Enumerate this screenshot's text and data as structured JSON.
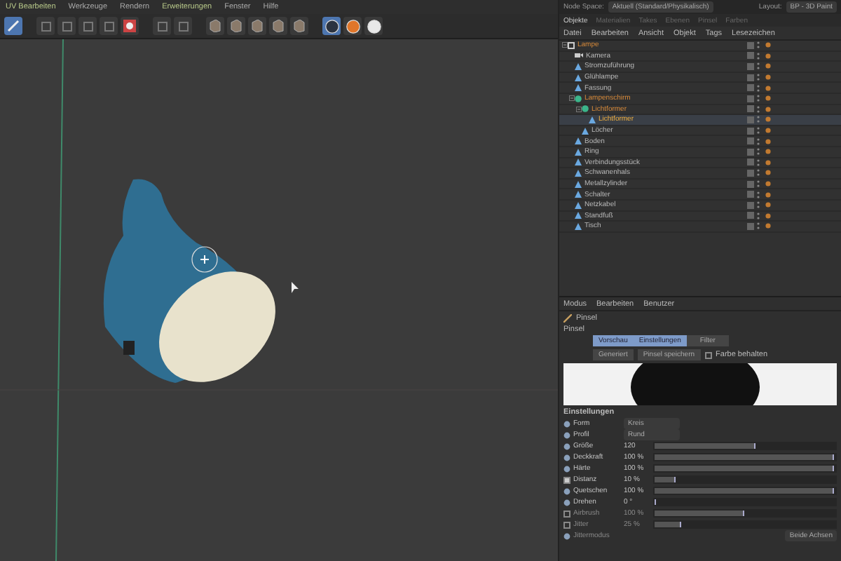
{
  "menu": [
    {
      "label": "UV Bearbeiten",
      "highlight": true
    },
    {
      "label": "Werkzeuge",
      "highlight": false
    },
    {
      "label": "Rendern",
      "highlight": false
    },
    {
      "label": "Erweiterungen",
      "highlight": true
    },
    {
      "label": "Fenster",
      "highlight": false
    },
    {
      "label": "Hilfe",
      "highlight": false
    }
  ],
  "toolbar": [
    {
      "kind": "brush",
      "selected": true
    },
    {
      "kind": "tool",
      "selected": false
    },
    {
      "kind": "tool",
      "selected": false
    },
    {
      "kind": "tool",
      "selected": false
    },
    {
      "kind": "tool",
      "selected": false
    },
    {
      "kind": "render",
      "selected": false
    },
    {
      "kind": "tool",
      "selected": false
    },
    {
      "kind": "tool",
      "selected": false
    },
    {
      "kind": "cube",
      "selected": false
    },
    {
      "kind": "cube",
      "selected": false
    },
    {
      "kind": "cube",
      "selected": false
    },
    {
      "kind": "cube",
      "selected": false
    },
    {
      "kind": "cube",
      "selected": false
    },
    {
      "kind": "s",
      "selected": true,
      "color": "#2b3340"
    },
    {
      "kind": "s",
      "selected": false,
      "color": "#e0762a"
    },
    {
      "kind": "s",
      "selected": false,
      "color": "#e8e8e8"
    }
  ],
  "header": {
    "node_space_label": "Node Space:",
    "node_space": "Aktuell (Standard/Physikalisch)",
    "layout_label": "Layout:",
    "layout": "BP - 3D Paint"
  },
  "object_tabs": [
    {
      "label": "Objekte",
      "selected": true
    },
    {
      "label": "Materialien",
      "selected": false
    },
    {
      "label": "Takes",
      "selected": false
    },
    {
      "label": "Ebenen",
      "selected": false
    },
    {
      "label": "Pinsel",
      "selected": false
    },
    {
      "label": "Farben",
      "selected": false
    }
  ],
  "object_menu": [
    "Datei",
    "Bearbeiten",
    "Ansicht",
    "Objekt",
    "Tags",
    "Lesezeichen"
  ],
  "objects": [
    {
      "name": "Lampe",
      "kind": "null",
      "selected": false,
      "expanded": true,
      "children": [
        {
          "name": "Kamera",
          "kind": "camera",
          "selected": false
        },
        {
          "name": "Stromzuführung",
          "kind": "mesh",
          "selected": false
        },
        {
          "name": "Glühlampe",
          "kind": "mesh",
          "selected": false
        },
        {
          "name": "Fassung",
          "kind": "mesh",
          "selected": false
        },
        {
          "name": "Lampenschirm",
          "kind": "group",
          "selected": false,
          "expanded": true,
          "children": [
            {
              "name": "Lichtformer",
              "kind": "group",
              "selected": false,
              "expanded": true,
              "children": [
                {
                  "name": "Lichtformer",
                  "kind": "mesh",
                  "selected": true
                }
              ]
            },
            {
              "name": "Löcher",
              "kind": "mesh",
              "selected": false
            }
          ]
        },
        {
          "name": "Boden",
          "kind": "mesh",
          "selected": false
        },
        {
          "name": "Ring",
          "kind": "mesh",
          "selected": false
        },
        {
          "name": "Verbindungsstück",
          "kind": "mesh",
          "selected": false
        },
        {
          "name": "Schwanenhals",
          "kind": "mesh",
          "selected": false
        },
        {
          "name": "Metallzylinder",
          "kind": "mesh",
          "selected": false
        },
        {
          "name": "Schalter",
          "kind": "mesh",
          "selected": false
        },
        {
          "name": "Netzkabel",
          "kind": "mesh",
          "selected": false
        },
        {
          "name": "Standfuß",
          "kind": "mesh",
          "selected": false
        },
        {
          "name": "Tisch",
          "kind": "mesh",
          "selected": false
        }
      ]
    }
  ],
  "attr_menu": [
    "Modus",
    "Bearbeiten",
    "Benutzer"
  ],
  "attr_title": "Pinsel",
  "section_label": "Pinsel",
  "brush_tabs": [
    {
      "label": "Vorschau",
      "selected": true
    },
    {
      "label": "Einstellungen",
      "selected": true
    },
    {
      "label": "Filter",
      "selected": false
    }
  ],
  "brush_preset": "Generiert",
  "save_button": "Pinsel speichern",
  "keep_color": {
    "label": "Farbe behalten",
    "checked": false
  },
  "settings_title": "Einstellungen",
  "settings": [
    {
      "label": "Form",
      "kind": "dropdown",
      "value": "Kreis",
      "disabled": false
    },
    {
      "label": "Profil",
      "kind": "dropdown",
      "value": "Rund",
      "disabled": false
    },
    {
      "label": "Größe",
      "kind": "slider",
      "value": "120",
      "level": 0.56,
      "disabled": false
    },
    {
      "label": "Deckkraft",
      "kind": "slider",
      "value": "100 %",
      "level": 1,
      "disabled": false
    },
    {
      "label": "Härte",
      "kind": "slider",
      "value": "100 %",
      "level": 1,
      "disabled": false
    },
    {
      "label": "Distanz",
      "kind": "slider",
      "value": "10 %",
      "level": 0.12,
      "checked": true,
      "disabled": false
    },
    {
      "label": "Quetschen",
      "kind": "slider",
      "value": "100 %",
      "level": 1,
      "disabled": false
    },
    {
      "label": "Drehen",
      "kind": "slider",
      "value": "0 °",
      "level": 0,
      "disabled": false
    },
    {
      "label": "Airbrush",
      "kind": "slider",
      "value": "100 %",
      "level": 0.5,
      "checked": false,
      "disabled": true
    },
    {
      "label": "Jitter",
      "kind": "slider",
      "value": "25 %",
      "level": 0.15,
      "checked": false,
      "disabled": true
    },
    {
      "label": "Jittermodus",
      "kind": "mode",
      "value": "Beide Achsen",
      "disabled": true
    }
  ]
}
